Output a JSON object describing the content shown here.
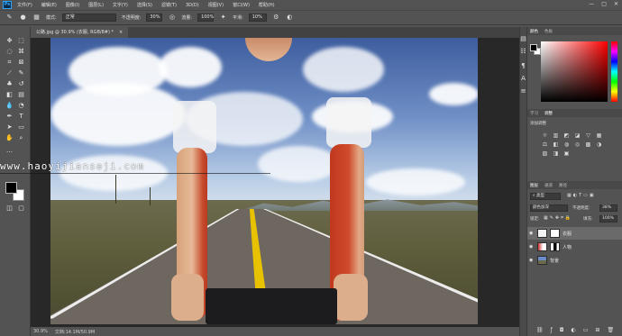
{
  "app": {
    "logo": "Ps"
  },
  "menu": [
    "文件(F)",
    "编辑(E)",
    "图像(I)",
    "图层(L)",
    "文字(Y)",
    "选择(S)",
    "滤镜(T)",
    "3D(D)",
    "视图(V)",
    "窗口(W)",
    "帮助(H)"
  ],
  "window_controls": [
    "—",
    "□",
    "✕"
  ],
  "options": {
    "mode_label": "模式:",
    "mode_value": "正常",
    "opacity_label": "不透明度:",
    "opacity_value": "30%",
    "flow_label": "流量:",
    "flow_value": "100%",
    "smooth_label": "平滑:",
    "smooth_value": "10%"
  },
  "document": {
    "tab_title": "公路.jpg @ 30.9% (衣服, RGB/8#) *",
    "close": "×"
  },
  "status": {
    "zoom": "30.9%",
    "info": "文档:14.1M/50.9M"
  },
  "watermark": "www.haoyijianseji.com",
  "panels": {
    "color_tabs": [
      "颜色",
      "色板"
    ],
    "adjust_tabs": [
      "学习",
      "调整"
    ],
    "adjust_title": "添加调整",
    "layers_tabs": [
      "图层",
      "通道",
      "路径"
    ],
    "filter_label": "类型",
    "blend_mode": "颜色加深",
    "opacity_label": "不透明度:",
    "opacity_value": "38%",
    "lock_label": "锁定:",
    "fill_label": "填充:",
    "fill_value": "100%",
    "layers": [
      {
        "name": "衣服",
        "selected": true
      },
      {
        "name": "人物",
        "selected": false
      },
      {
        "name": "背景",
        "selected": false
      }
    ]
  },
  "colors": {
    "ui_bg": "#535353",
    "canvas_bg": "#282828",
    "accent": "#31a8ff"
  }
}
